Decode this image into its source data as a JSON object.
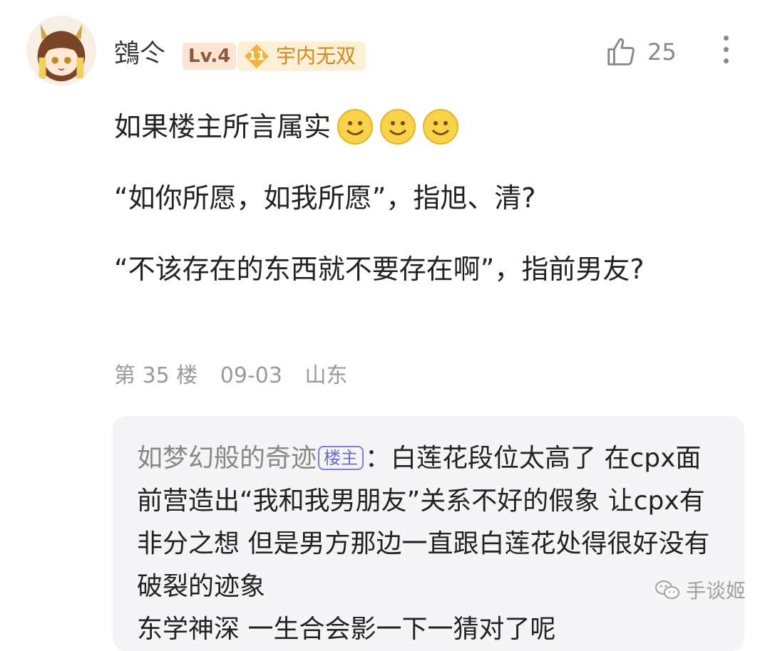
{
  "user": {
    "name": "鵼仒",
    "level": "Lv.4",
    "title_level": "11",
    "title": "宇内无双"
  },
  "likes": {
    "count": "25"
  },
  "comment": {
    "line1": "如果楼主所言属实",
    "line2": "“如你所愿，如我所愿”，指旭、清?",
    "line3": "“不该存在的东西就不要存在啊”，指前男友?"
  },
  "meta": {
    "floor": "第 35 楼",
    "date": "09-03",
    "location": "山东"
  },
  "reply": {
    "author": "如梦幻般的奇迹",
    "op_badge": "楼主",
    "separator": "：",
    "text": "白莲花段位太高了 在cpx面前营造出“我和我男朋友”关系不好的假象 让cpx有非分之想 但是男方那边一直跟白莲花处得很好没有破裂的迹象",
    "next_partial": "东学神深 一生合会影一下一猜对了呢"
  },
  "watermark": {
    "text": "手谈姬"
  },
  "icons": {
    "like": "thumbs-up-icon",
    "more": "more-vertical-icon",
    "emoji": "smiley-emoji-icon",
    "badge": "diamond-badge-icon",
    "wechat": "wechat-icon"
  },
  "colors": {
    "level_bg": "#fbe4d4",
    "title_color": "#d08a1d",
    "op_badge": "#6d6cc9",
    "reply_bg": "#f5f5f7",
    "meta": "#9a9a9a"
  }
}
